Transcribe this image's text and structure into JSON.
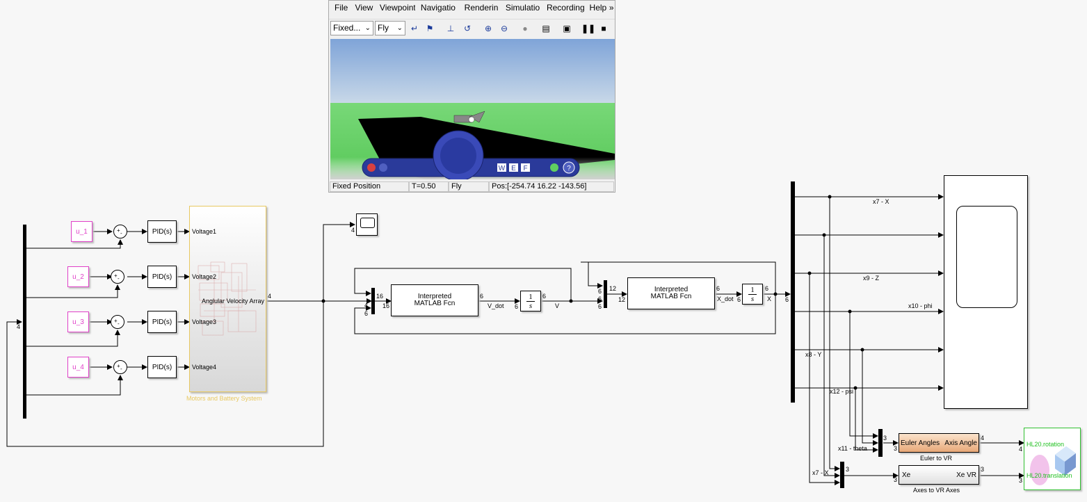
{
  "vr_window": {
    "menu": [
      "File",
      "View",
      "Viewpoint",
      "Navigatio",
      "Renderin",
      "Simulatio",
      "Recording",
      "Help"
    ],
    "menu_overflow": "»",
    "viewpoint_combo": "Fixed...",
    "nav_mode_combo": "Fly",
    "nav_panel_buttons": [
      "W",
      "E",
      "F"
    ],
    "status": {
      "viewpoint": "Fixed Position",
      "time": "T=0.50",
      "mode": "Fly",
      "position": "Pos:[-254.74 16.22 -143.56]"
    }
  },
  "diagram": {
    "steps": [
      "u_1",
      "u_2",
      "u_3",
      "u_4"
    ],
    "pid_label": "PID(s)",
    "voltages": [
      "Voltage1",
      "Voltage2",
      "Voltage3",
      "Voltage4"
    ],
    "motors_block_title": "Motors and Battery System",
    "motors_block_output": "Anglular Velocity Array",
    "fcn_label_line1": "Interpreted",
    "fcn_label_line2": "MATLAB Fcn",
    "integrator_num": "1",
    "integrator_den": "s",
    "signal_labels": {
      "v_dot": "V_dot",
      "v": "V",
      "x_dot": "X_dot",
      "x": "X",
      "x7": "x7 - X",
      "x9": "x9 - Z",
      "x10": "x10 - phi",
      "x8": "x8 - Y",
      "x12": "x12 - psi",
      "x11": "x11 - theta",
      "x7b": "x7 - X"
    },
    "dims": {
      "d4": "4",
      "d16": "16",
      "d6": "6",
      "d12": "12",
      "d3": "3"
    },
    "euler_block": {
      "in": "Euler Angles",
      "out": "Axis Angle",
      "caption": "Euler to VR"
    },
    "axes_block": {
      "in": "Xe",
      "out": "Xe VR",
      "caption": "Axes to VR Axes"
    },
    "vr_sink": {
      "rotation": "HL20.rotation",
      "translation": "HL20.translation"
    }
  }
}
